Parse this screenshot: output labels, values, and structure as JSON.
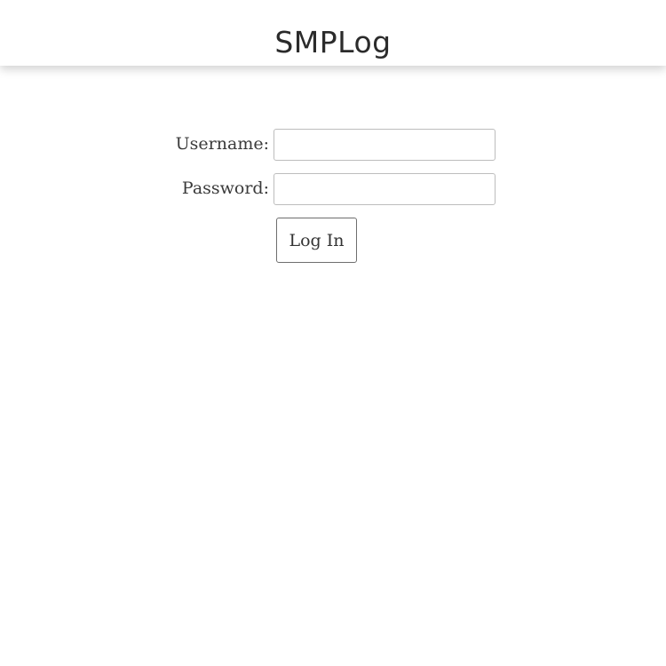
{
  "header": {
    "title": "SMPLog"
  },
  "login_form": {
    "username_label": "Username:",
    "username_value": "",
    "password_label": "Password:",
    "password_value": "",
    "submit_label": "Log In"
  }
}
